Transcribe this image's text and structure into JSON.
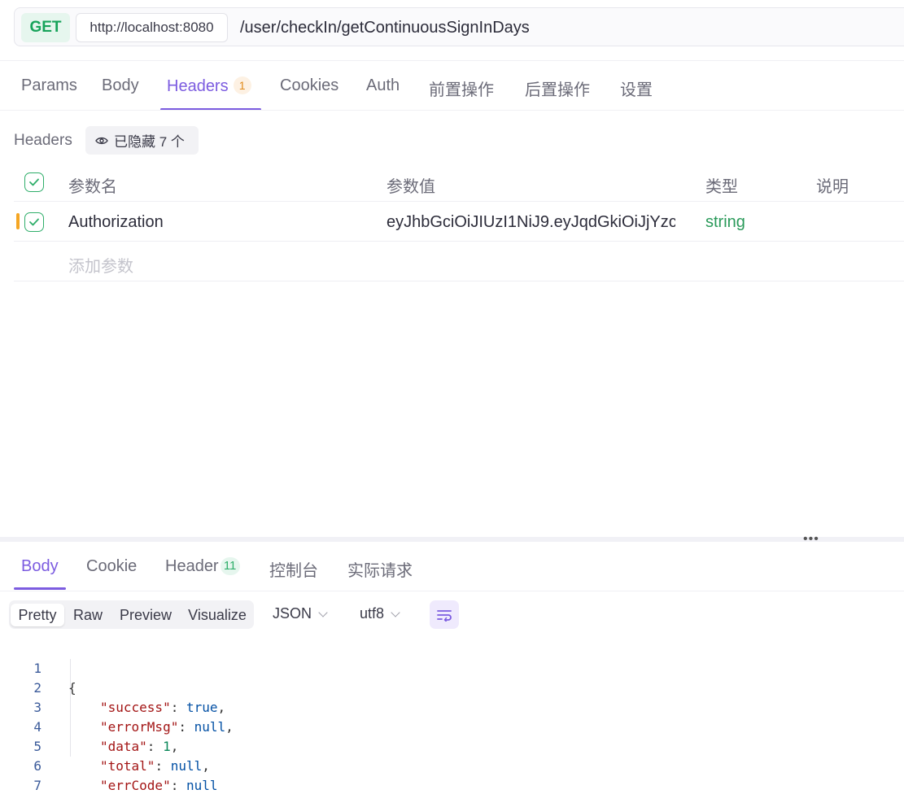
{
  "request": {
    "method": "GET",
    "host": "http://localhost:8080",
    "path": "/user/checkIn/getContinuousSignInDays"
  },
  "request_tabs": [
    {
      "label": "Params"
    },
    {
      "label": "Body"
    },
    {
      "label": "Headers",
      "badge": "1",
      "active": true
    },
    {
      "label": "Cookies"
    },
    {
      "label": "Auth"
    },
    {
      "label": "前置操作"
    },
    {
      "label": "后置操作"
    },
    {
      "label": "设置"
    }
  ],
  "headers_panel": {
    "label": "Headers",
    "hidden_text": "已隐藏 7 个",
    "columns": [
      "参数名",
      "参数值",
      "类型",
      "说明"
    ],
    "rows": [
      {
        "name": "Authorization",
        "value": "eyJhbGciOiJIUzI1NiJ9.eyJqdGkiOiJjYzcy",
        "type": "string",
        "description": "",
        "checked": true
      }
    ],
    "add_placeholder": "添加参数"
  },
  "response_tabs": [
    {
      "label": "Body",
      "active": true
    },
    {
      "label": "Cookie"
    },
    {
      "label": "Header",
      "badge": "11"
    },
    {
      "label": "控制台"
    },
    {
      "label": "实际请求"
    }
  ],
  "view_modes": [
    "Pretty",
    "Raw",
    "Preview",
    "Visualize"
  ],
  "active_view_mode": "Pretty",
  "format": "JSON",
  "encoding": "utf8",
  "response_body_lines": [
    {
      "n": "1",
      "text": "{"
    },
    {
      "n": "2",
      "key": "\"success\"",
      "value": "true",
      "comma": ","
    },
    {
      "n": "3",
      "key": "\"errorMsg\"",
      "value": "null",
      "comma": ","
    },
    {
      "n": "4",
      "key": "\"data\"",
      "value": "1",
      "comma": ","
    },
    {
      "n": "5",
      "key": "\"total\"",
      "value": "null",
      "comma": ","
    },
    {
      "n": "6",
      "key": "\"errCode\"",
      "value": "null",
      "comma": ""
    },
    {
      "n": "7",
      "text": "}"
    }
  ],
  "colors": {
    "accent": "#7c5ce0",
    "get_method": "#17a35a",
    "badge_orange": "#e08a1a",
    "type_green": "#2a9a5a",
    "json_key": "#a31515",
    "json_value": "#0451a5"
  }
}
